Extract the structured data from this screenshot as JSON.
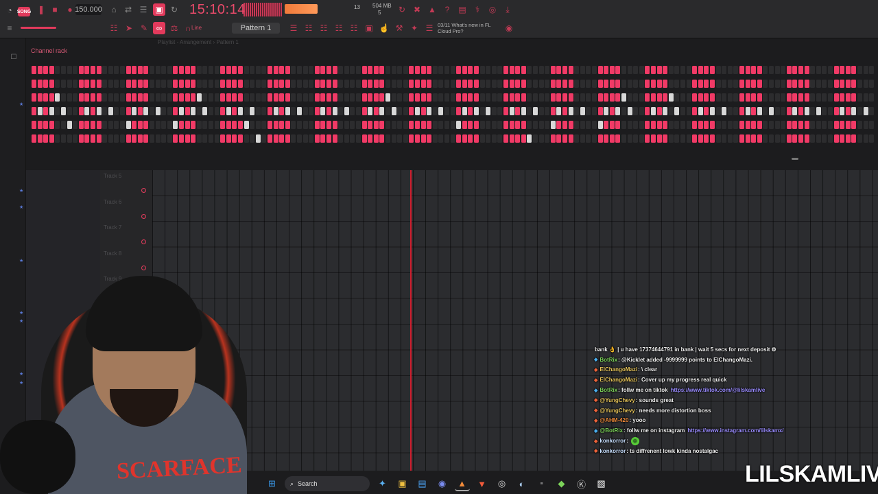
{
  "toolbar": {
    "song_mode": "SONG",
    "tempo": "150.000",
    "clock": "15:10:14",
    "cpu_cores": "13",
    "memory": "504 MB",
    "memory_sub": "5",
    "pattern": "Pattern 1",
    "snap": "Line",
    "news_date": "03/11",
    "news_text": "What's new in FL Cloud Pro?"
  },
  "channel_rack": {
    "title": "Channel rack",
    "ghost_title": "Playlist - Arrangement › Pattern 1",
    "rows": [
      "1111000011110000111100001111000011110000111100001111000011110000111100001111000011110000111100001111000011110000111100001111000011110000111100001",
      "1111000011110000111100001111000011110000111100001111000011110000111100001111000011110000111100001111000011110000111100001111000011110000111100001",
      "1111200011110000111100001111200011110000111100001111000011112000111100001111000011110000111100001111200011112000111100001111000011110000111100001",
      "1212020012120200121202001212020012120200121202001212020012120200121202001212020012120200121202001212020012120200121202001212020012120200121202001",
      "1111002011110000211100002111000011112000111100001111000011110000111100002111000011110000211100002111000011110000111100001111000011110000111100001",
      "1111000011110000111100001111000011110020111100001111000011110000111100001111000011112000111100001111000011110000111100001111000011110000111100002"
    ]
  },
  "playlist": {
    "tracks": [
      "Track 5",
      "Track 6",
      "Track 7",
      "Track 8",
      "Track 9"
    ]
  },
  "chat": [
    {
      "user": "",
      "text": "bank 👌 | u have 17374644791 in bank | wait 5 secs for next deposit ⚙",
      "link": "",
      "user_class": ""
    },
    {
      "user": "BotRix",
      "text": ": @Kicklet added -9999999 points to ElChangoMazi.",
      "link": "",
      "user_class": "u-green"
    },
    {
      "user": "ElChangoMazi",
      "text": ": \\ clear",
      "link": "",
      "user_class": "u-gold"
    },
    {
      "user": "ElChangoMazi",
      "text": ": Cover up my progress real quick",
      "link": "",
      "user_class": "u-gold"
    },
    {
      "user": "BotRix",
      "text": ": follw me on tiktok",
      "link": "https://www.tiktok.com/@lilskamlive",
      "user_class": "u-green"
    },
    {
      "user": "@YungChevy",
      "text": ": sounds great",
      "link": "",
      "user_class": "u-gold"
    },
    {
      "user": "@YungChevy",
      "text": ": needs more distortion boss",
      "link": "",
      "user_class": "u-gold"
    },
    {
      "user": "@AHM-420",
      "text": ": yooo",
      "link": "",
      "user_class": "u-orange"
    },
    {
      "user": "@BotRix",
      "text": ": follw me on instagram",
      "link": "https://www.instagram.com/lilskamx/",
      "user_class": "u-green"
    },
    {
      "user": "konkorror",
      "text": ":",
      "link": "",
      "user_class": "u-light"
    },
    {
      "user": "konkorror",
      "text": ": ts diffrenent lowk kinda nostalgac",
      "link": "",
      "user_class": "u-light"
    }
  ],
  "webcam": {
    "shirt_text": "SCARFACE"
  },
  "taskbar": {
    "search_placeholder": "Search"
  },
  "watermark": "LILSKAMLIVE",
  "colors": {
    "accent": "#f13a66",
    "playhead": "#d21e2e",
    "background": "#1c1c1e"
  }
}
